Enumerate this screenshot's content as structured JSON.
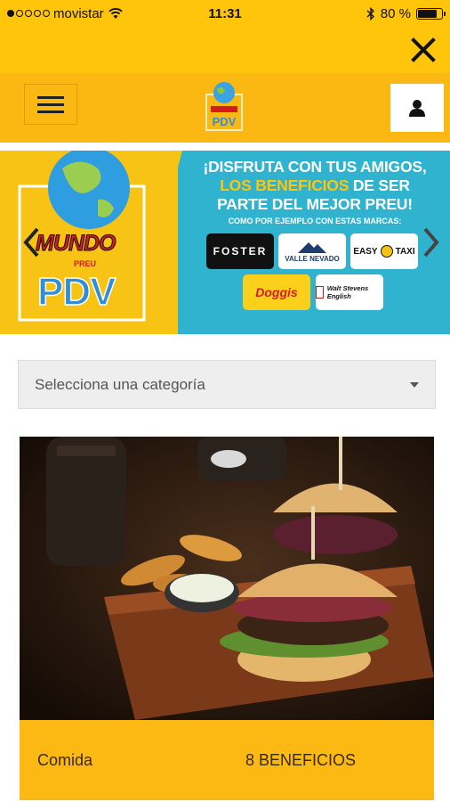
{
  "status_bar": {
    "carrier": "movistar",
    "time": "11:31",
    "battery": "80 %",
    "battery_level": 0.8,
    "signal_bars_filled": 1,
    "signal_bars_total": 5
  },
  "close_bar": {
    "close_icon": "close-icon"
  },
  "header": {
    "menu_icon": "hamburger-icon",
    "logo_text": "PDV",
    "user_icon": "user-icon"
  },
  "banner": {
    "logo_mundo": "MUNDO",
    "logo_preu": "PREU",
    "logo_pdv": "PDV",
    "title_line1": "¡DISFRUTA CON TUS AMIGOS,",
    "title_highlight": "LOS BENEFICIOS",
    "title_line2_rest": " DE SER",
    "title_line3": "PARTE DEL MEJOR PREU!",
    "subtitle": "COMO POR EJEMPLO CON ESTAS MARCAS:",
    "brands": {
      "foster": "FOSTER",
      "valle": "VALLE NEVADO",
      "easy": "EASY",
      "easy_taxi": "TAXI",
      "doggis": "Doggis",
      "stevens": "Walt Stevens English"
    }
  },
  "category_select": {
    "placeholder": "Selecciona una categoría"
  },
  "category_card": {
    "name": "Comida",
    "count": "8 BENEFICIOS"
  },
  "colors": {
    "brand_yellow": "#fec50a",
    "header_orange": "#fbb812",
    "banner_teal": "#2fb3cf",
    "card_footer": "#fcb913"
  }
}
